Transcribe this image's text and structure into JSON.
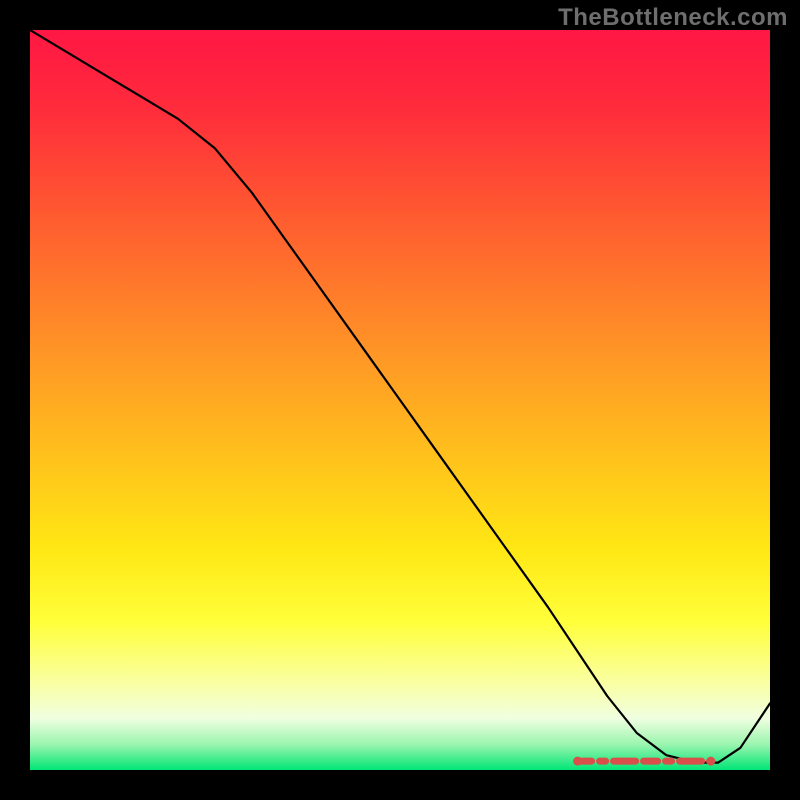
{
  "watermark": "TheBottleneck.com",
  "chart_data": {
    "type": "line",
    "title": "",
    "xlabel": "",
    "ylabel": "",
    "xlim": [
      0,
      100
    ],
    "ylim": [
      0,
      100
    ],
    "grid": false,
    "legend": false,
    "background_gradient": {
      "stops": [
        {
          "offset": 0.0,
          "color": "#ff1744"
        },
        {
          "offset": 0.1,
          "color": "#ff2a3c"
        },
        {
          "offset": 0.25,
          "color": "#ff5a30"
        },
        {
          "offset": 0.4,
          "color": "#ff8a28"
        },
        {
          "offset": 0.55,
          "color": "#ffb91e"
        },
        {
          "offset": 0.7,
          "color": "#ffe714"
        },
        {
          "offset": 0.8,
          "color": "#ffff3a"
        },
        {
          "offset": 0.88,
          "color": "#faffa0"
        },
        {
          "offset": 0.93,
          "color": "#f0ffe0"
        },
        {
          "offset": 0.965,
          "color": "#9cf5b0"
        },
        {
          "offset": 1.0,
          "color": "#00e676"
        }
      ]
    },
    "series": [
      {
        "name": "curve",
        "color": "#000000",
        "x": [
          0,
          5,
          10,
          15,
          20,
          25,
          30,
          35,
          40,
          45,
          50,
          55,
          60,
          65,
          70,
          74,
          78,
          82,
          86,
          90,
          93,
          96,
          100
        ],
        "y": [
          100,
          97,
          94,
          91,
          88,
          84,
          78,
          71,
          64,
          57,
          50,
          43,
          36,
          29,
          22,
          16,
          10,
          5,
          2,
          1,
          1,
          3,
          9
        ]
      }
    ],
    "markers": {
      "name": "dash-band",
      "color": "#d94f4a",
      "y": 1.2,
      "x_start": 74,
      "x_end": 92,
      "pattern": "dash"
    }
  }
}
